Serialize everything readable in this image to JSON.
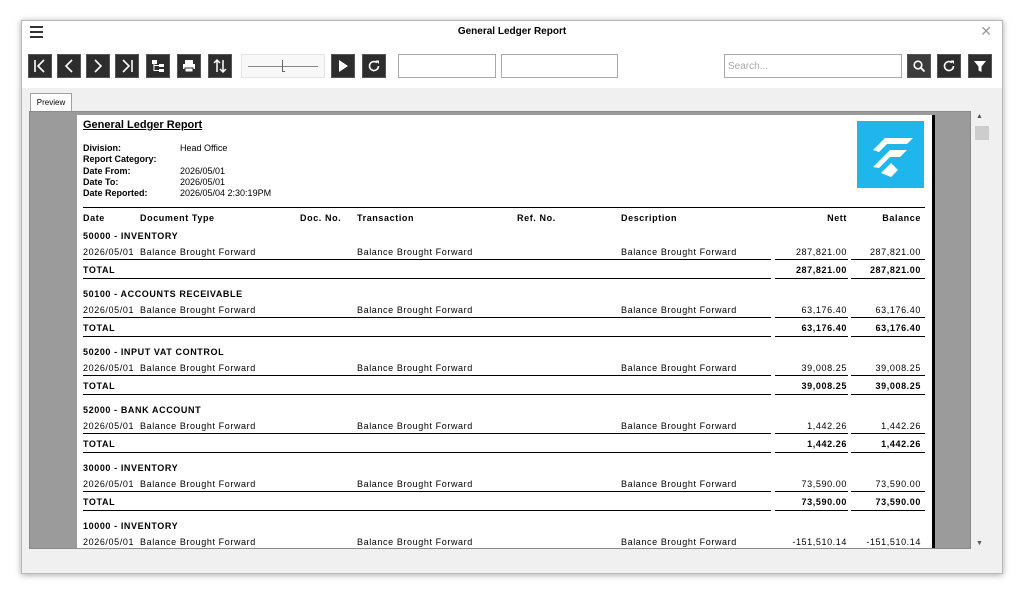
{
  "window": {
    "title": "General Ledger Report"
  },
  "toolbar": {
    "first_page": "first-page",
    "search_placeholder": "Search..."
  },
  "tabs": [
    {
      "label": "Preview"
    }
  ],
  "report": {
    "title": "General Ledger Report",
    "info": [
      {
        "label": "Division:",
        "value": "Head Office"
      },
      {
        "label": "Report Category:",
        "value": ""
      },
      {
        "label": "Date From:",
        "value": "2026/05/01"
      },
      {
        "label": "Date To:",
        "value": "2026/05/01"
      },
      {
        "label": "Date Reported:",
        "value": "2026/05/04 2:30:19PM"
      }
    ],
    "columns": {
      "date": "Date",
      "document_type": "Document Type",
      "doc_no": "Doc. No.",
      "transaction": "Transaction",
      "ref_no": "Ref. No.",
      "description": "Description",
      "nett": "Nett",
      "balance": "Balance"
    },
    "total_label": "TOTAL",
    "groups": [
      {
        "name": "50000 - INVENTORY",
        "rows": [
          {
            "date": "2026/05/01",
            "document_type": "Balance Brought Forward",
            "transaction": "Balance Brought Forward",
            "description": "Balance Brought Forward",
            "nett": "287,821.00",
            "balance": "287,821.00"
          }
        ],
        "total_nett": "287,821.00",
        "total_balance": "287,821.00"
      },
      {
        "name": "50100 - ACCOUNTS RECEIVABLE",
        "rows": [
          {
            "date": "2026/05/01",
            "document_type": "Balance Brought Forward",
            "transaction": "Balance Brought Forward",
            "description": "Balance Brought Forward",
            "nett": "63,176.40",
            "balance": "63,176.40"
          }
        ],
        "total_nett": "63,176.40",
        "total_balance": "63,176.40"
      },
      {
        "name": "50200 - INPUT VAT CONTROL",
        "rows": [
          {
            "date": "2026/05/01",
            "document_type": "Balance Brought Forward",
            "transaction": "Balance Brought Forward",
            "description": "Balance Brought Forward",
            "nett": "39,008.25",
            "balance": "39,008.25"
          }
        ],
        "total_nett": "39,008.25",
        "total_balance": "39,008.25"
      },
      {
        "name": "52000 - BANK ACCOUNT",
        "rows": [
          {
            "date": "2026/05/01",
            "document_type": "Balance Brought Forward",
            "transaction": "Balance Brought Forward",
            "description": "Balance Brought Forward",
            "nett": "1,442.26",
            "balance": "1,442.26"
          }
        ],
        "total_nett": "1,442.26",
        "total_balance": "1,442.26"
      },
      {
        "name": "30000 - INVENTORY",
        "rows": [
          {
            "date": "2026/05/01",
            "document_type": "Balance Brought Forward",
            "transaction": "Balance Brought Forward",
            "description": "Balance Brought Forward",
            "nett": "73,590.00",
            "balance": "73,590.00"
          }
        ],
        "total_nett": "73,590.00",
        "total_balance": "73,590.00"
      },
      {
        "name": "10000 - INVENTORY",
        "rows": [
          {
            "date": "2026/05/01",
            "document_type": "Balance Brought Forward",
            "transaction": "Balance Brought Forward",
            "description": "Balance Brought Forward",
            "nett": "-151,510.14",
            "balance": "-151,510.14"
          }
        ],
        "total_nett": "",
        "total_balance": ""
      }
    ]
  },
  "colors": {
    "logo": "#1fb6ee",
    "button": "#2d2d2d"
  },
  "icons": {
    "menu": "hamburger-icon",
    "close": "close-icon",
    "search": "search-icon",
    "refresh": "refresh-icon",
    "filter": "filter-icon",
    "logo": "brand-logo"
  }
}
